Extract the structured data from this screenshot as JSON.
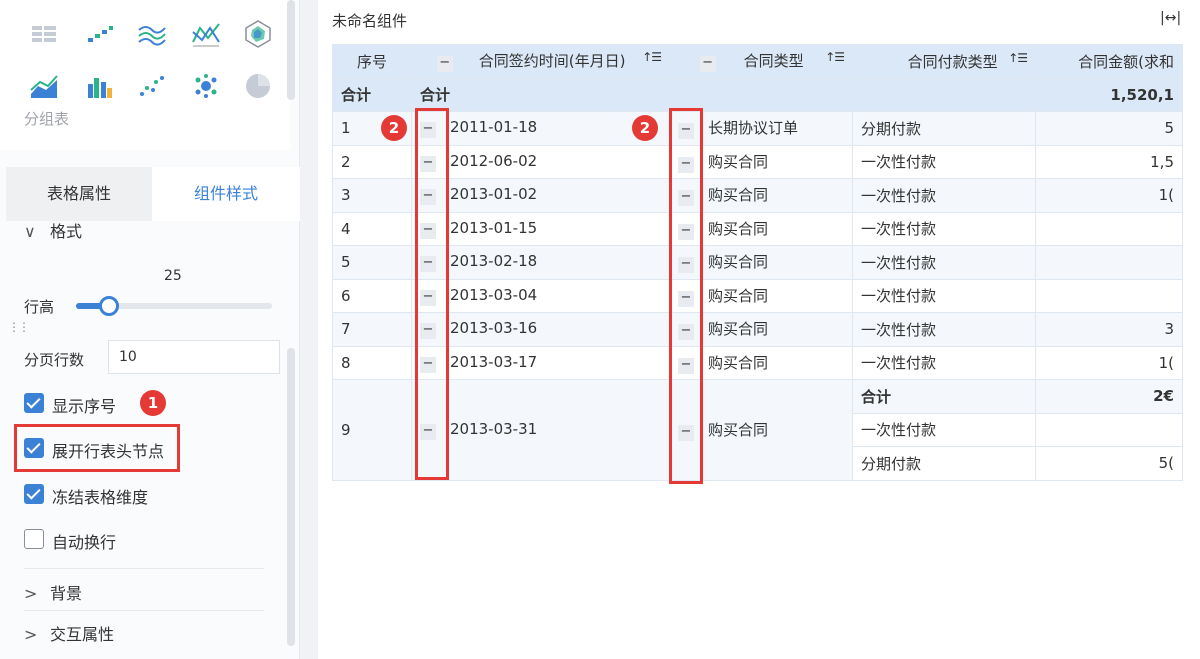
{
  "sidebar": {
    "chart_icons": [
      "group-table-icon",
      "scatter-stair-icon",
      "stacked-line-icon",
      "multi-line-icon",
      "radar-icon",
      "area-icon",
      "multi-bar-icon",
      "scatter-icon",
      "bubble-icon",
      "pie-icon"
    ],
    "group_label": "分组表",
    "tabs": [
      {
        "label": "表格属性",
        "active": false
      },
      {
        "label": "组件样式",
        "active": true
      }
    ],
    "format_section": "格式",
    "row_height_value": "25",
    "row_height_label": "行高",
    "row_height_fraction": 0.17,
    "page_rows_label": "分页行数",
    "page_rows_value": "10",
    "checkboxes": [
      {
        "label": "显示序号",
        "checked": true
      },
      {
        "label": "展开行表头节点",
        "checked": true
      },
      {
        "label": "冻结表格维度",
        "checked": true
      },
      {
        "label": "自动换行",
        "checked": false
      }
    ],
    "background_section": "背景",
    "interaction_section": "交互属性",
    "badge1": "1"
  },
  "component": {
    "title": "未命名组件",
    "expand_glyph": "|↔|",
    "badge2": "2"
  },
  "table": {
    "headers": {
      "seq": "序号",
      "date": "合同签约时间(年月日)",
      "type": "合同类型",
      "pay": "合同付款类型",
      "amount": "合同金额(求和"
    },
    "total_label": "合计",
    "grand_total": "1,520,1",
    "rows": [
      {
        "seq": "1",
        "date": "2011-01-18",
        "type": "长期协议订单",
        "pay": "分期付款",
        "amount": "5"
      },
      {
        "seq": "2",
        "date": "2012-06-02",
        "type": "购买合同",
        "pay": "一次性付款",
        "amount": "1,5"
      },
      {
        "seq": "3",
        "date": "2013-01-02",
        "type": "购买合同",
        "pay": "一次性付款",
        "amount": "1("
      },
      {
        "seq": "4",
        "date": "2013-01-15",
        "type": "购买合同",
        "pay": "一次性付款",
        "amount": ""
      },
      {
        "seq": "5",
        "date": "2013-02-18",
        "type": "购买合同",
        "pay": "一次性付款",
        "amount": ""
      },
      {
        "seq": "6",
        "date": "2013-03-04",
        "type": "购买合同",
        "pay": "一次性付款",
        "amount": ""
      },
      {
        "seq": "7",
        "date": "2013-03-16",
        "type": "购买合同",
        "pay": "一次性付款",
        "amount": "3"
      },
      {
        "seq": "8",
        "date": "2013-03-17",
        "type": "购买合同",
        "pay": "一次性付款",
        "amount": "1("
      }
    ],
    "row9": {
      "seq": "9",
      "date": "2013-03-31",
      "type": "购买合同",
      "sub": [
        {
          "pay": "合计",
          "amount": "2€",
          "bold": true
        },
        {
          "pay": "一次性付款",
          "amount": ""
        },
        {
          "pay": "分期付款",
          "amount": "5("
        }
      ]
    },
    "minus_glyph": "−",
    "sort_glyph": "↑☰"
  }
}
